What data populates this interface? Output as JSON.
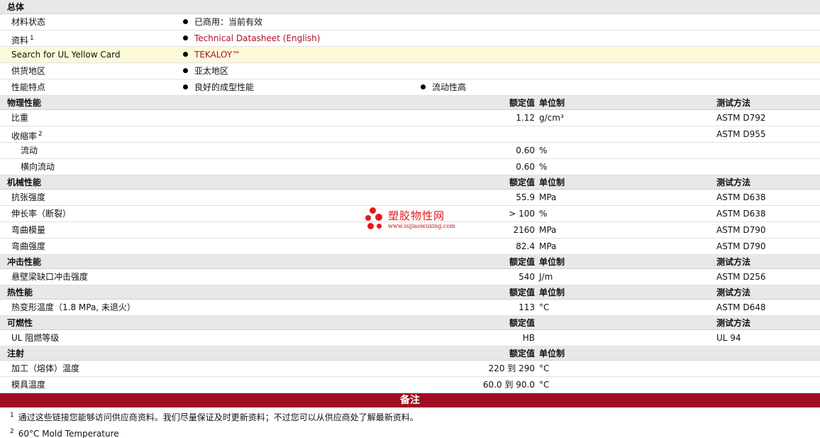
{
  "general": {
    "title": "总体",
    "rows": [
      {
        "label": "材料状态",
        "items": [
          "已商用：当前有效"
        ]
      },
      {
        "label": "资料",
        "sup": "1",
        "items": [
          "Technical Datasheet (English)"
        ],
        "link": true
      },
      {
        "label": "Search for UL Yellow Card",
        "items": [
          "TEKALOY™"
        ],
        "link": true,
        "highlight": true
      },
      {
        "label": "供货地区",
        "items": [
          "亚太地区"
        ]
      },
      {
        "label": "性能特点",
        "items": [
          "良好的成型性能",
          "流动性高"
        ]
      }
    ]
  },
  "columns": {
    "rated": "额定值",
    "unit": "单位制",
    "test": "测试方法"
  },
  "physical": {
    "title": "物理性能",
    "rows": [
      {
        "label": "比重",
        "value": "1.12",
        "unit": "g/cm³",
        "test": "ASTM D792"
      },
      {
        "label": "收缩率",
        "sup": "2",
        "value": "",
        "unit": "",
        "test": "ASTM D955"
      },
      {
        "label": "流动",
        "value": "0.60",
        "unit": "%",
        "test": ""
      },
      {
        "label": "横向流动",
        "value": "0.60",
        "unit": "%",
        "test": ""
      }
    ]
  },
  "mechanical": {
    "title": "机械性能",
    "rows": [
      {
        "label": "抗张强度",
        "value": "55.9",
        "unit": "MPa",
        "test": "ASTM D638"
      },
      {
        "label": "伸长率（断裂）",
        "value": "> 100",
        "unit": "%",
        "test": "ASTM D638"
      },
      {
        "label": "弯曲模量",
        "value": "2160",
        "unit": "MPa",
        "test": "ASTM D790"
      },
      {
        "label": "弯曲强度",
        "value": "82.4",
        "unit": "MPa",
        "test": "ASTM D790"
      }
    ]
  },
  "impact": {
    "title": "冲击性能",
    "rows": [
      {
        "label": "悬壁梁缺口冲击强度",
        "value": "540",
        "unit": "J/m",
        "test": "ASTM D256"
      }
    ]
  },
  "thermal": {
    "title": "热性能",
    "rows": [
      {
        "label": "热变形温度（1.8 MPa, 未退火）",
        "value": "113",
        "unit": "°C",
        "test": "ASTM D648"
      }
    ]
  },
  "flammability": {
    "title": "可燃性",
    "rows": [
      {
        "label": "UL 阻燃等级",
        "value": "HB",
        "unit": "",
        "test": "UL 94"
      }
    ]
  },
  "injection": {
    "title": "注射",
    "rows": [
      {
        "label": "加工（熔体）温度",
        "value": "220 到  290",
        "unit": "°C",
        "test": ""
      },
      {
        "label": "模具温度",
        "value": "60.0 到  90.0",
        "unit": "°C",
        "test": ""
      }
    ]
  },
  "notes": {
    "title": "备注",
    "items": [
      {
        "num": "1",
        "text": "通过这些链接您能够访问供应商资料。我们尽量保证及时更新资料；不过您可以从供应商处了解最新资料。"
      },
      {
        "num": "2",
        "text": "60°C Mold Temperature"
      }
    ]
  },
  "watermark": {
    "title": "塑胶物性网",
    "url": "www.sujiaowuxing.com"
  },
  "colors": {
    "accent": "#a00c22",
    "link": "#b0102a",
    "header_bg": "#e8e8e8",
    "highlight_bg": "#fbf9d8"
  }
}
